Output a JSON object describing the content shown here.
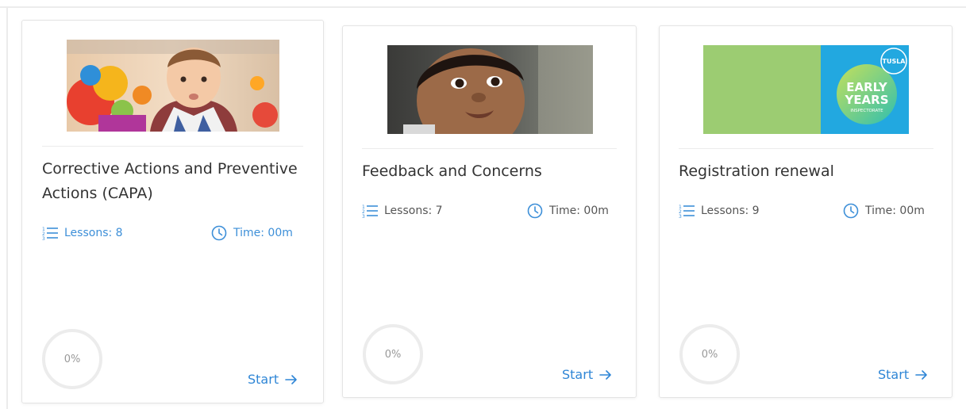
{
  "courses": [
    {
      "title": "Corrective Actions and Preventive Actions (CAPA)",
      "lessons": "Lessons: 8",
      "time": "Time: 00m",
      "progress": "0%",
      "progress_value": 0,
      "action": "Start",
      "image": "baby-with-toys-photo"
    },
    {
      "title": "Feedback and Concerns",
      "lessons": "Lessons: 7",
      "time": "Time: 00m",
      "progress": "0%",
      "progress_value": 0,
      "action": "Start",
      "image": "baby-face-photo"
    },
    {
      "title": "Registration renewal",
      "lessons": "Lessons: 9",
      "time": "Time: 00m",
      "progress": "0%",
      "progress_value": 0,
      "action": "Start",
      "image": "tusla-early-years-banner"
    }
  ],
  "banner": {
    "logo_text": "TUSLA",
    "line1": "EARLY",
    "line2": "YEARS",
    "line3": "INSPECTORATE"
  },
  "colors": {
    "accent": "#2f86d6",
    "active_meta": "#3d8fd8",
    "banner_green": "#9ccc72",
    "banner_blue": "#22a8e0"
  }
}
